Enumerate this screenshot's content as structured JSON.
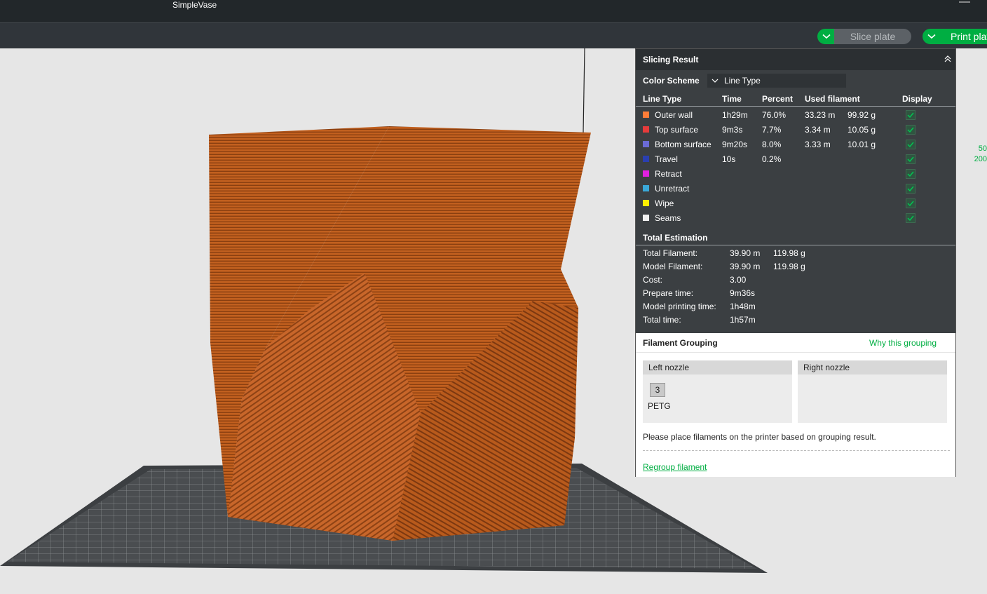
{
  "window": {
    "title": "SimpleVase",
    "minimize": "—"
  },
  "toolbar": {
    "slice_label": "Slice plate",
    "print_label": "Print plate"
  },
  "viewport": {
    "side_labels": [
      "50",
      "200"
    ]
  },
  "slicing_result": {
    "title": "Slicing Result",
    "color_scheme": {
      "label": "Color Scheme",
      "value": "Line Type"
    },
    "headers": {
      "line_type": "Line Type",
      "time": "Time",
      "percent": "Percent",
      "used_filament": "Used filament",
      "display": "Display"
    },
    "rows": [
      {
        "name": "Outer wall",
        "color": "#ff7d38",
        "time": "1h29m",
        "percent": "76.0%",
        "length": "33.23 m",
        "weight": "99.92 g"
      },
      {
        "name": "Top surface",
        "color": "#e63b3b",
        "time": "9m3s",
        "percent": "7.7%",
        "length": "3.34 m",
        "weight": "10.05 g"
      },
      {
        "name": "Bottom surface",
        "color": "#6b6bd6",
        "time": "9m20s",
        "percent": "8.0%",
        "length": "3.33 m",
        "weight": "10.01 g"
      },
      {
        "name": "Travel",
        "color": "#2a3fb0",
        "time": "10s",
        "percent": "0.2%",
        "length": "",
        "weight": ""
      },
      {
        "name": "Retract",
        "color": "#e020e0",
        "time": "",
        "percent": "",
        "length": "",
        "weight": ""
      },
      {
        "name": "Unretract",
        "color": "#3aa8d8",
        "time": "",
        "percent": "",
        "length": "",
        "weight": ""
      },
      {
        "name": "Wipe",
        "color": "#ffee00",
        "time": "",
        "percent": "",
        "length": "",
        "weight": ""
      },
      {
        "name": "Seams",
        "color": "#f0f0f0",
        "time": "",
        "percent": "",
        "length": "",
        "weight": ""
      }
    ],
    "total_estimation": {
      "title": "Total Estimation",
      "items": [
        {
          "label": "Total Filament:",
          "v1": "39.90 m",
          "v2": "119.98 g"
        },
        {
          "label": "Model Filament:",
          "v1": "39.90 m",
          "v2": "119.98 g"
        },
        {
          "label": "Cost:",
          "v1": "3.00",
          "v2": ""
        },
        {
          "label": "Prepare time:",
          "v1": "9m36s",
          "v2": ""
        },
        {
          "label": "Model printing time:",
          "v1": "1h48m",
          "v2": ""
        },
        {
          "label": "Total time:",
          "v1": "1h57m",
          "v2": ""
        }
      ]
    },
    "filament_grouping": {
      "title": "Filament Grouping",
      "why_link": "Why this grouping",
      "left_nozzle": "Left nozzle",
      "right_nozzle": "Right nozzle",
      "filament_number": "3",
      "filament_type": "PETG",
      "note": "Please place filaments on the printer based on grouping result.",
      "regroup_link": "Regroup filament"
    }
  },
  "colors": {
    "accent": "#00ae42",
    "model": "#c45e1e",
    "panel_bg": "#3b3f42"
  }
}
